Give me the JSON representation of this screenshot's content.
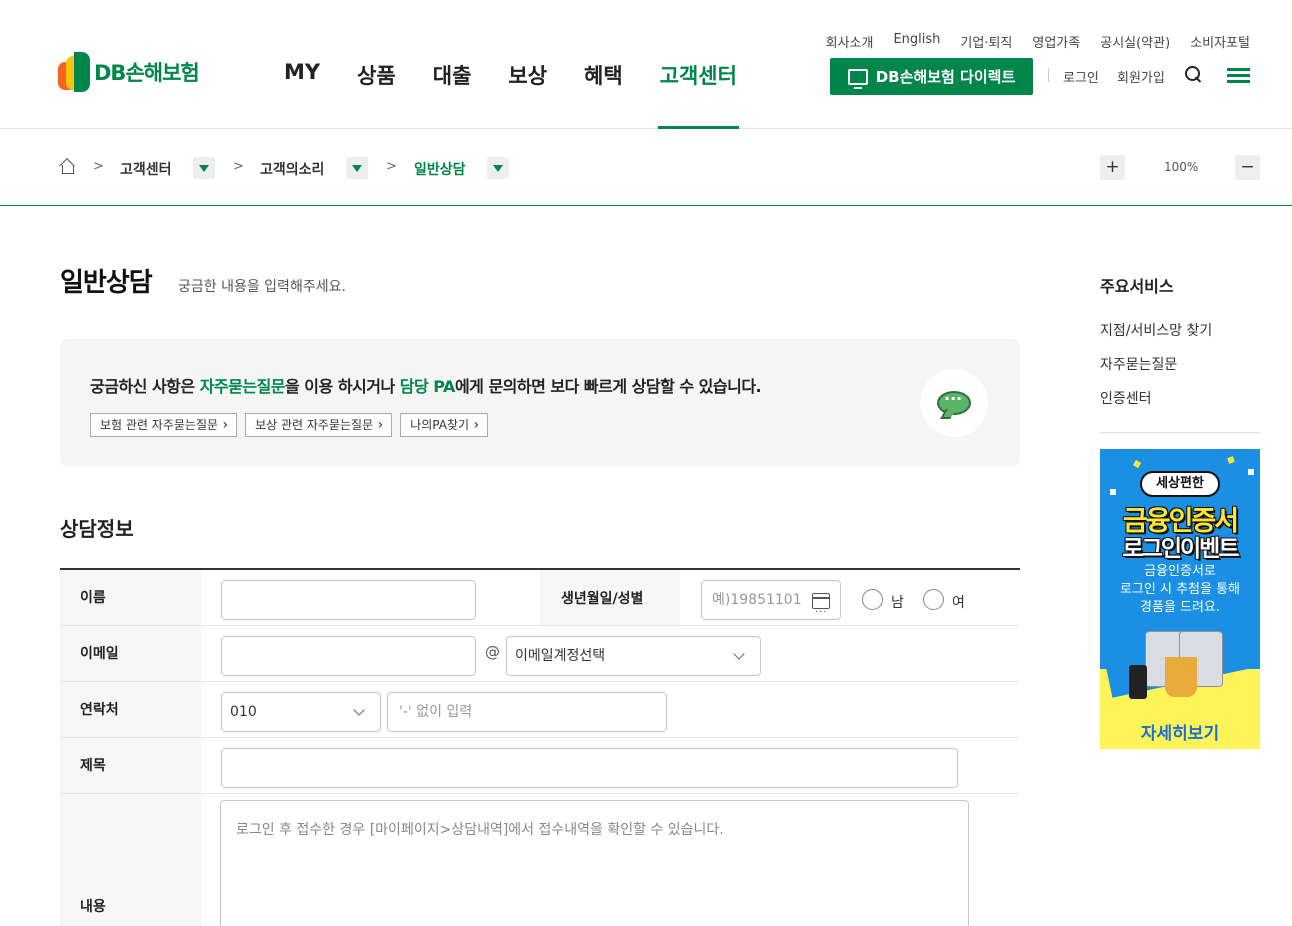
{
  "header": {
    "logo": "DB손해보험",
    "gnb": [
      "MY",
      "상품",
      "대출",
      "보상",
      "혜택",
      "고객센터"
    ],
    "util_top": [
      "회사소개",
      "English",
      "기업·퇴직",
      "영업가족",
      "공시실(약관)",
      "소비자포털"
    ],
    "direct_btn": "DB손해보험 다이렉트",
    "login": "로그인",
    "signup": "회원가입"
  },
  "breadcrumb": {
    "items": [
      "고객센터",
      "고객의소리",
      "일반상담"
    ],
    "separator": ">",
    "zoom": "100%",
    "zoom_in": "+",
    "zoom_out": "−"
  },
  "page": {
    "title": "일반상담",
    "subtitle": "궁금한 내용을 입력해주세요."
  },
  "notice": {
    "t1": "궁금하신 사항은 ",
    "hl1": "자주묻는질문",
    "t2": "을 이용 하시거나 ",
    "hl2": "담당 PA",
    "t3": "에게 문의하면 보다 빠르게 상담할 수 있습니다.",
    "links": [
      "보험 관련 자주묻는질문",
      "보상 관련 자주묻는질문",
      "나의PA찾기"
    ]
  },
  "form": {
    "section_title": "상담정보",
    "name_label": "이름",
    "birth_label": "생년월일/성별",
    "birth_placeholder": "예)19851101",
    "male": "남",
    "female": "여",
    "email_label": "이메일",
    "at": "@",
    "email_domain": "이메일계정선택",
    "phone_label": "연락처",
    "phone_prefix": "010",
    "phone_placeholder": "'-' 없이 입력",
    "subject_label": "제목",
    "content_label": "내용",
    "content_placeholder": "로그인 후 접수한 경우 [마이페이지>상담내역]에서 접수내역을 확인할 수 있습니다."
  },
  "sidebar": {
    "title": "주요서비스",
    "links": [
      "지점/서비스망 찾기",
      "자주묻는질문",
      "인증센터"
    ]
  },
  "banner": {
    "pill": "세상편한",
    "line1": "금융인증서",
    "line2": "로그인이벤트",
    "desc1": "금융인증서로",
    "desc2": "로그인 시 추첨을 통해",
    "desc3": "경품을 드려요.",
    "cta": "자세히보기"
  },
  "colors": {
    "brand": "#00854a",
    "banner_bg": "#1a8fe3",
    "banner_yellow": "#fff35a"
  }
}
